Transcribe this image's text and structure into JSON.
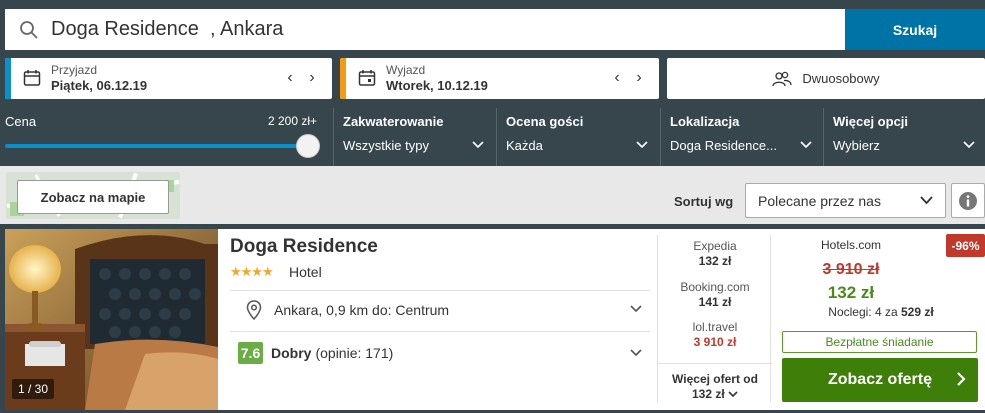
{
  "search": {
    "query": "Doga Residence  , Ankara",
    "button_label": "Szukaj"
  },
  "dates": {
    "checkin_label": "Przyjazd",
    "checkin_value": "Piątek, 06.12.19",
    "checkout_label": "Wyjazd",
    "checkout_value": "Wtorek, 10.12.19",
    "prev_arrow": "‹",
    "next_arrow": "›"
  },
  "room": {
    "label": "Dwuosobowy"
  },
  "filters": {
    "price_label": "Cena",
    "price_max": "2 200 zł+",
    "price_slider_fraction": 1.0,
    "accommodation": {
      "title": "Zakwaterowanie",
      "value": "Wszystkie typy"
    },
    "guest_rating": {
      "title": "Ocena gości",
      "value": "Każda"
    },
    "location": {
      "title": "Lokalizacja",
      "value": "Doga Residence..."
    },
    "more": {
      "title": "Więcej opcji",
      "value": "Wybierz"
    }
  },
  "sort": {
    "map_button": "Zobacz na mapie",
    "label": "Sortuj wg",
    "selected": "Polecane przez nas"
  },
  "hotel": {
    "name": "Doga Residence",
    "stars": "★★★★",
    "star_count": 4,
    "type": "Hotel",
    "photo_count": "1 / 30",
    "location": "Ankara, 0,9 km do: Centrum",
    "rating_score": "7.6",
    "rating_label": "Dobry",
    "rating_count": "(opinie: 171)",
    "providers": [
      {
        "name": "Expedia",
        "price": "132 zł"
      },
      {
        "name": "Booking.com",
        "price": "141 zł"
      },
      {
        "name": "lol.travel",
        "price": "3 910 zł"
      }
    ],
    "more_offers_line1": "Więcej ofert od",
    "more_offers_line2": "132 zł",
    "deal": {
      "provider": "Hotels.com",
      "discount": "-96%",
      "old_price": "3 910 zł",
      "new_price": "132 zł",
      "nights_prefix": "Noclegi: 4 za",
      "nights_total": "529 zł",
      "breakfast": "Bezpłatne śniadanie",
      "cta": "Zobacz ofertę"
    }
  },
  "colors": {
    "header_bg": "#37454d",
    "search_button": "#0073a6",
    "checkin_accent": "#0a90c8",
    "checkout_accent": "#f39c12",
    "cta_green": "#3e7f0a",
    "discount_red": "#c0392b",
    "rating_green": "#6aac46"
  }
}
